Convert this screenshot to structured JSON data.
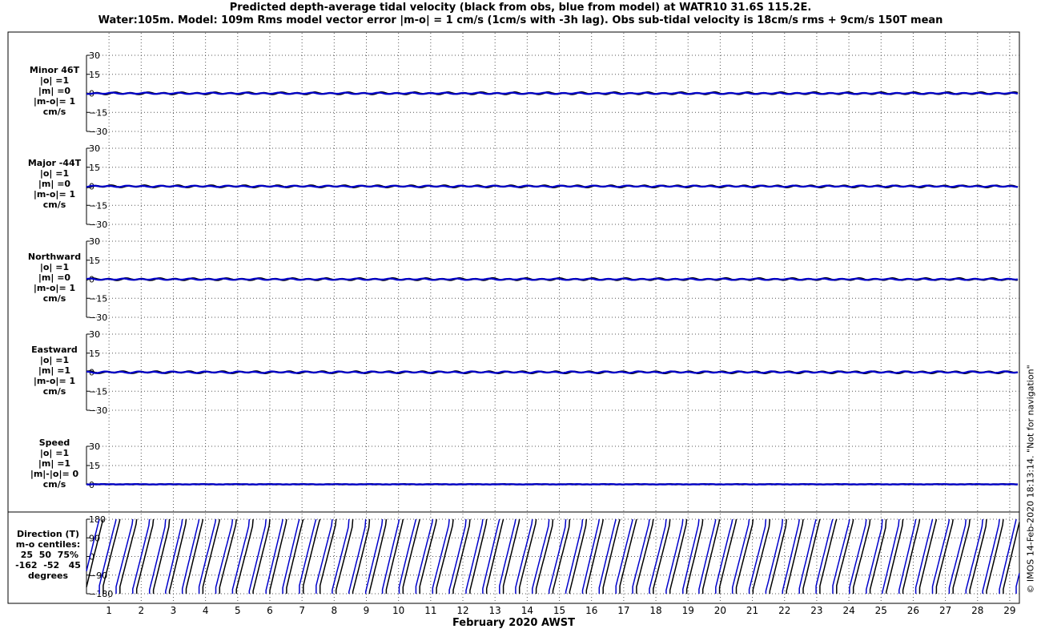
{
  "title_line1": "Predicted depth-average tidal velocity (black from obs, blue from model) at WATR10 31.6S 115.2E.",
  "title_line2": "Water:105m. Model: 109m  Rms model vector error |m-o| = 1 cm/s (1cm/s with -3h lag). Obs sub-tidal velocity is 18cm/s rms + 9cm/s 150T mean",
  "copyright": "© IMOS 14-Feb-2020 18:13:14.  \"Not for navigation\"",
  "colors": {
    "obs": "#000000",
    "model": "#0000cc",
    "grid": "#555555",
    "frame": "#000000"
  },
  "chart_data": [
    {
      "type": "line",
      "panel": "minor",
      "label_lines": [
        "Minor 46T",
        "|o| =1",
        "|m| =0",
        "|m-o|= 1",
        "cm/s"
      ],
      "ylim": [
        -30,
        30
      ],
      "yticks": [
        30,
        15,
        0,
        -15,
        -30
      ],
      "xlim": [
        0.3,
        29.3
      ],
      "grid": true,
      "series": [
        {
          "color_key": "obs",
          "amplitude": 0.9
        },
        {
          "color_key": "model",
          "amplitude": 0.6
        }
      ]
    },
    {
      "type": "line",
      "panel": "major",
      "label_lines": [
        "Major -44T",
        "|o| =1",
        "|m| =0",
        "|m-o|= 1",
        "cm/s"
      ],
      "ylim": [
        -30,
        30
      ],
      "yticks": [
        30,
        15,
        0,
        -15,
        -30
      ],
      "xlim": [
        0.3,
        29.3
      ],
      "grid": true,
      "series": [
        {
          "color_key": "obs",
          "amplitude": 0.9
        },
        {
          "color_key": "model",
          "amplitude": 0.6
        }
      ]
    },
    {
      "type": "line",
      "panel": "northward",
      "label_lines": [
        "Northward",
        "|o| =1",
        "|m| =0",
        "|m-o|= 1",
        "cm/s"
      ],
      "ylim": [
        -30,
        30
      ],
      "yticks": [
        30,
        15,
        0,
        -15,
        -30
      ],
      "xlim": [
        0.3,
        29.3
      ],
      "grid": true,
      "series": [
        {
          "color_key": "obs",
          "amplitude": 0.9
        },
        {
          "color_key": "model",
          "amplitude": 0.6
        }
      ]
    },
    {
      "type": "line",
      "panel": "eastward",
      "label_lines": [
        "Eastward",
        "|o| =1",
        "|m| =1",
        "|m-o|= 1",
        "cm/s"
      ],
      "ylim": [
        -30,
        30
      ],
      "yticks": [
        30,
        15,
        0,
        -15,
        -30
      ],
      "xlim": [
        0.3,
        29.3
      ],
      "grid": true,
      "series": [
        {
          "color_key": "obs",
          "amplitude": 0.9
        },
        {
          "color_key": "model",
          "amplitude": 0.7
        }
      ]
    },
    {
      "type": "line",
      "panel": "speed",
      "label_lines": [
        "Speed",
        "|o| =1",
        "|m| =1",
        "|m|-|o|= 0",
        "cm/s"
      ],
      "ylim": [
        0,
        30
      ],
      "yticks": [
        30,
        15,
        0
      ],
      "xlim": [
        0.3,
        29.3
      ],
      "grid": true,
      "series": [
        {
          "color_key": "obs",
          "amplitude": 0.6
        },
        {
          "color_key": "model",
          "amplitude": 0.6
        }
      ]
    },
    {
      "type": "line",
      "panel": "direction",
      "label_lines": [
        "Direction (T)",
        "m-o centiles:",
        " 25  50  75%",
        "-162  -52   45",
        "degrees"
      ],
      "ylim": [
        -180,
        180
      ],
      "yticks": [
        180,
        90,
        0,
        -90,
        -180
      ],
      "xlim": [
        0.3,
        29.3
      ],
      "grid": true,
      "series": [
        {
          "color_key": "obs",
          "lag_days": 0.0
        },
        {
          "color_key": "model",
          "lag_days": 0.12
        }
      ]
    }
  ],
  "xticks": [
    "1",
    "2",
    "3",
    "4",
    "5",
    "6",
    "7",
    "8",
    "9",
    "10",
    "11",
    "12",
    "13",
    "14",
    "15",
    "16",
    "17",
    "18",
    "19",
    "20",
    "21",
    "22",
    "23",
    "24",
    "25",
    "26",
    "27",
    "28",
    "29"
  ],
  "xlabel": "February 2020 AWST"
}
